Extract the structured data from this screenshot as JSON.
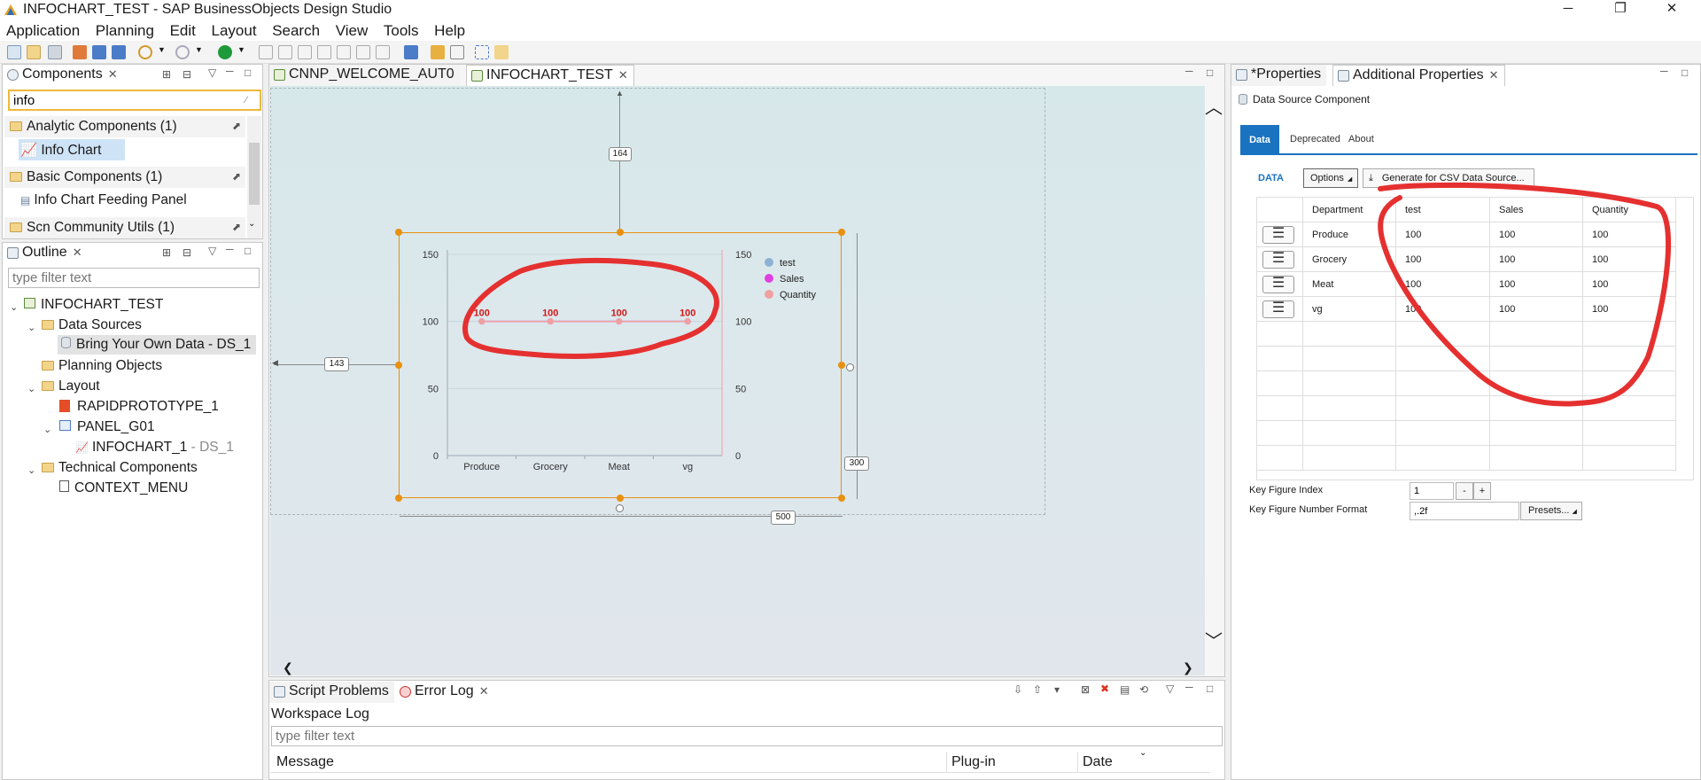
{
  "window": {
    "title": "INFOCHART_TEST - SAP BusinessObjects Design Studio",
    "controls": [
      "─",
      "❐",
      "✕"
    ]
  },
  "menu": [
    "Application",
    "Planning",
    "Edit",
    "Layout",
    "Search",
    "View",
    "Tools",
    "Help"
  ],
  "components_view": {
    "tab_label": "Components",
    "search_value": "info",
    "groups": [
      {
        "label": "Analytic Components (1)",
        "items": [
          "Info Chart"
        ]
      },
      {
        "label": "Basic Components (1)",
        "items": [
          "Info Chart Feeding Panel"
        ]
      },
      {
        "label": "Scn Community Utils (1)",
        "items": []
      }
    ]
  },
  "outline_view": {
    "tab_label": "Outline",
    "filter_placeholder": "type filter text",
    "tree": {
      "root": "INFOCHART_TEST",
      "data_sources": "Data Sources",
      "ds_item": "Bring Your Own Data - DS_1",
      "planning": "Planning Objects",
      "layout": "Layout",
      "rapid": "RAPIDPROTOTYPE_1",
      "panel": "PANEL_G01",
      "chart": "INFOCHART_1",
      "chart_suffix": "- DS_1",
      "technical": "Technical Components",
      "context_menu": "CONTEXT_MENU"
    }
  },
  "editor": {
    "tabs": [
      "CNNP_WELCOME_AUT0",
      "INFOCHART_TEST"
    ],
    "dimensions": {
      "top": "164",
      "left": "143",
      "height": "300",
      "width": "500"
    }
  },
  "chart_data": {
    "type": "line",
    "categories": [
      "Produce",
      "Grocery",
      "Meat",
      "vg"
    ],
    "series": [
      {
        "name": "test",
        "values": [
          100,
          100,
          100,
          100
        ],
        "color": "#8eb0d4"
      },
      {
        "name": "Sales",
        "values": [
          100,
          100,
          100,
          100
        ],
        "color": "#e040e0"
      },
      {
        "name": "Quantity",
        "values": [
          100,
          100,
          100,
          100
        ],
        "color": "#f0a0a0"
      }
    ],
    "data_labels": [
      "100",
      "100",
      "100",
      "100"
    ],
    "yticks_left": [
      "150",
      "100",
      "50",
      "0"
    ],
    "yticks_right": [
      "150",
      "100",
      "50",
      "0"
    ],
    "ylim": [
      0,
      150
    ],
    "legend_position": "top-right",
    "grid": true
  },
  "properties_view": {
    "tabs": [
      "*Properties",
      "Additional Properties"
    ],
    "heading": "Data Source Component",
    "subtabs": [
      "Data",
      "Deprecated",
      "About"
    ],
    "section_label": "DATA",
    "options_button": "Options",
    "generate_button": "Generate for CSV Data Source...",
    "table": {
      "headers": [
        "Department",
        "test",
        "Sales",
        "Quantity"
      ],
      "rows": [
        [
          "Produce",
          "100",
          "100",
          "100"
        ],
        [
          "Grocery",
          "100",
          "100",
          "100"
        ],
        [
          "Meat",
          "100",
          "100",
          "100"
        ],
        [
          "vg",
          "100",
          "100",
          "100"
        ]
      ]
    },
    "key_figure_index_label": "Key Figure Index",
    "key_figure_index_value": "1",
    "minus": "-",
    "plus": "+",
    "number_format_label": "Key Figure Number Format",
    "number_format_value": ",.2f",
    "presets_button": "Presets..."
  },
  "bottom_view": {
    "tabs": [
      "Script Problems",
      "Error Log"
    ],
    "title": "Workspace Log",
    "filter_placeholder": "type filter text",
    "columns": [
      "Message",
      "Plug-in",
      "Date"
    ]
  }
}
